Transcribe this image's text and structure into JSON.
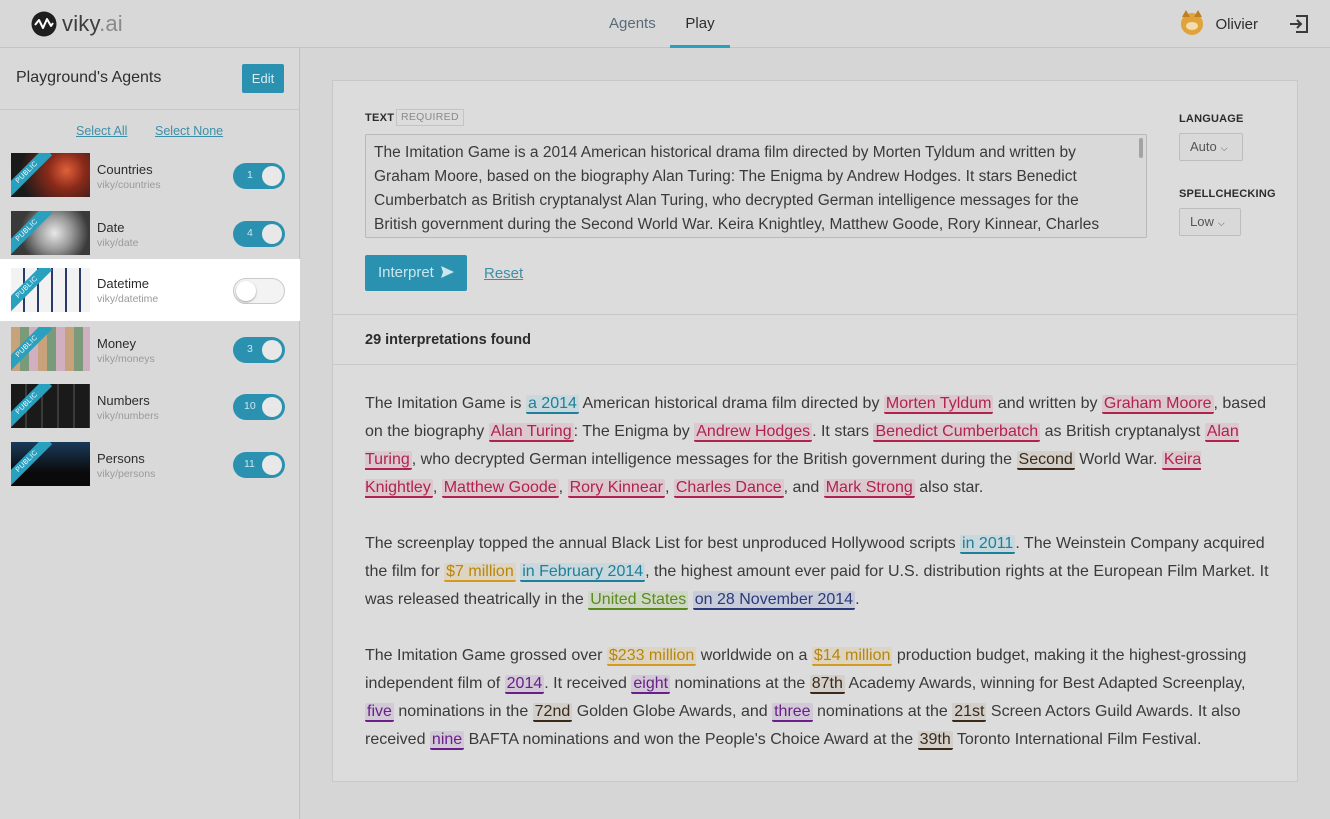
{
  "header": {
    "logo_text": "viky",
    "logo_suffix": ".ai",
    "tabs": [
      {
        "label": "Agents",
        "active": false
      },
      {
        "label": "Play",
        "active": true
      }
    ],
    "user_name": "Olivier"
  },
  "sidebar": {
    "title": "Playground's Agents",
    "edit_label": "Edit",
    "select_all": "Select All",
    "select_none": "Select None",
    "agents": [
      {
        "name": "Countries",
        "slug": "viky/countries",
        "count": "1",
        "enabled": true,
        "badge": "PUBLIC"
      },
      {
        "name": "Date",
        "slug": "viky/date",
        "count": "4",
        "enabled": true,
        "badge": "PUBLIC"
      },
      {
        "name": "Datetime",
        "slug": "viky/datetime",
        "count": "",
        "enabled": false,
        "badge": "PUBLIC"
      },
      {
        "name": "Money",
        "slug": "viky/moneys",
        "count": "3",
        "enabled": true,
        "badge": "PUBLIC"
      },
      {
        "name": "Numbers",
        "slug": "viky/numbers",
        "count": "10",
        "enabled": true,
        "badge": "PUBLIC"
      },
      {
        "name": "Persons",
        "slug": "viky/persons",
        "count": "11",
        "enabled": true,
        "badge": "PUBLIC"
      }
    ]
  },
  "form": {
    "text_label": "TEXT",
    "required_badge": "REQUIRED",
    "text_value": "The Imitation Game is a 2014 American historical drama film directed by Morten Tyldum and written by Graham Moore, based on the biography Alan Turing: The Enigma by Andrew Hodges. It stars Benedict Cumberbatch as British cryptanalyst Alan Turing, who decrypted German intelligence messages for the British government during the Second World War. Keira Knightley, Matthew Goode, Rory Kinnear, Charles",
    "interpret_label": "Interpret",
    "reset_label": "Reset",
    "language_label": "LANGUAGE",
    "language_value": "Auto",
    "spellcheck_label": "SPELLCHECKING",
    "spellcheck_value": "Low"
  },
  "results": {
    "count_text": "29 interpretations found",
    "colors": {
      "person": "#b0234e",
      "date": "#1e7f9a",
      "datetime": "#2a3a7a",
      "number": "#3a2a1a",
      "money": "#d49a1e",
      "country": "#5a8a1e",
      "word_number": "#6a1e8a"
    },
    "paragraphs": [
      [
        {
          "t": "The Imitation Game is "
        },
        {
          "t": "a 2014",
          "c": "date"
        },
        {
          "t": " American historical drama film directed by "
        },
        {
          "t": "Morten Tyldum",
          "c": "person"
        },
        {
          "t": " and written by "
        },
        {
          "t": "Graham Moore",
          "c": "person"
        },
        {
          "t": ", based on the biography "
        },
        {
          "t": "Alan Turing",
          "c": "person"
        },
        {
          "t": ": The Enigma by "
        },
        {
          "t": "Andrew Hodges",
          "c": "person"
        },
        {
          "t": ". It stars "
        },
        {
          "t": "Benedict Cumberbatch",
          "c": "person"
        },
        {
          "t": " as British cryptanalyst "
        },
        {
          "t": "Alan Turing",
          "c": "person"
        },
        {
          "t": ", who decrypted German intelligence messages for the British government during the "
        },
        {
          "t": "Second",
          "c": "number"
        },
        {
          "t": " World War. "
        },
        {
          "t": "Keira Knightley",
          "c": "person"
        },
        {
          "t": ", "
        },
        {
          "t": "Matthew Goode",
          "c": "person"
        },
        {
          "t": ", "
        },
        {
          "t": "Rory Kinnear",
          "c": "person"
        },
        {
          "t": ", "
        },
        {
          "t": "Charles Dance",
          "c": "person"
        },
        {
          "t": ", and "
        },
        {
          "t": "Mark Strong",
          "c": "person"
        },
        {
          "t": " also star."
        }
      ],
      [
        {
          "t": "The screenplay topped the annual Black List for best unproduced Hollywood scripts "
        },
        {
          "t": "in 2011",
          "c": "date"
        },
        {
          "t": ". The Weinstein Company acquired the film for "
        },
        {
          "t": "$7 million",
          "c": "money"
        },
        {
          "t": " "
        },
        {
          "t": "in February 2014",
          "c": "date"
        },
        {
          "t": ", the highest amount ever paid for U.S. distribution rights at the European Film Market. It was released theatrically in the "
        },
        {
          "t": "United States",
          "c": "country"
        },
        {
          "t": " "
        },
        {
          "t": "on 28 November 2014",
          "c": "datetime"
        },
        {
          "t": "."
        }
      ],
      [
        {
          "t": "The Imitation Game grossed over "
        },
        {
          "t": "$233 million",
          "c": "money"
        },
        {
          "t": " worldwide on a "
        },
        {
          "t": "$14 million",
          "c": "money"
        },
        {
          "t": " production budget, making it the highest-grossing independent film of "
        },
        {
          "t": "2014",
          "c": "word_number"
        },
        {
          "t": ". It received "
        },
        {
          "t": "eight",
          "c": "word_number"
        },
        {
          "t": " nominations at the "
        },
        {
          "t": "87th",
          "c": "number"
        },
        {
          "t": " Academy Awards, winning for Best Adapted Screenplay, "
        },
        {
          "t": "five",
          "c": "word_number"
        },
        {
          "t": " nominations in the "
        },
        {
          "t": "72nd",
          "c": "number"
        },
        {
          "t": " Golden Globe Awards, and "
        },
        {
          "t": "three",
          "c": "word_number"
        },
        {
          "t": " nominations at the "
        },
        {
          "t": "21st",
          "c": "number"
        },
        {
          "t": " Screen Actors Guild Awards. It also received "
        },
        {
          "t": "nine",
          "c": "word_number"
        },
        {
          "t": " BAFTA nominations and won the People's Choice Award at the "
        },
        {
          "t": "39th",
          "c": "number"
        },
        {
          "t": " Toronto International Film Festival."
        }
      ]
    ]
  }
}
